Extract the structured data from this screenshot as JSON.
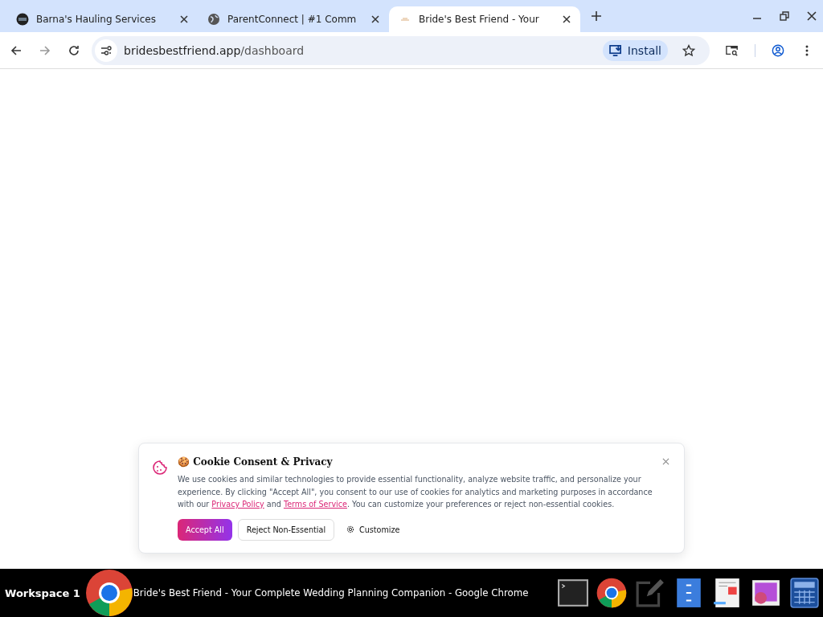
{
  "tabs": [
    {
      "title": "Barna's Hauling Services",
      "selected": false
    },
    {
      "title": "ParentConnect | #1 Comm",
      "selected": false
    },
    {
      "title": "Bride's Best Friend - Your",
      "selected": true
    }
  ],
  "address": {
    "host": "bridesbestfriend.app",
    "path": "/dashboard"
  },
  "install_button": "Install",
  "cookie_banner": {
    "title": "🍪 Cookie Consent & Privacy",
    "text_before": "We use cookies and similar technologies to provide essential functionality, analyze website traffic, and personalize your experience. By clicking \"Accept All\", you consent to our use of cookies for analytics and marketing purposes in accordance with our ",
    "privacy_link": "Privacy Policy",
    "text_middle": " and ",
    "terms_link": "Terms of Service",
    "text_after": ". You can customize your preferences or reject non-essential cookies.",
    "buttons": [
      {
        "label": "Accept All",
        "kind": "primary"
      },
      {
        "label": "Reject Non-Essential",
        "kind": "secondary"
      },
      {
        "label": "Customize",
        "kind": "settings"
      }
    ]
  },
  "taskbar": {
    "workspace": "Workspace 1",
    "window_title": "Bride's Best Friend - Your Complete Wedding Planning Companion - Google Chrome"
  }
}
